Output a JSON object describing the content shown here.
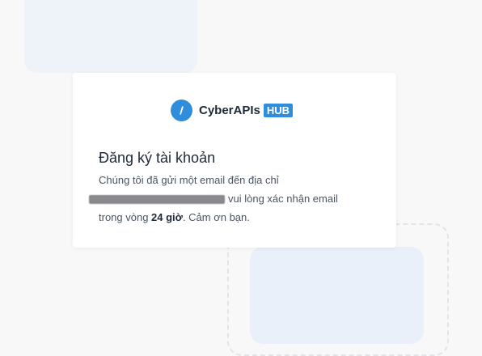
{
  "brand": {
    "name": "CyberAPIs",
    "badge": "HUB",
    "logo_glyph": "/",
    "accent_color": "#2f8ddb"
  },
  "card": {
    "title": "Đăng ký tài khoản",
    "message_line1": "Chúng tôi đã gửi một email đến địa chỉ",
    "message_after_email": "vui lòng xác nhận email",
    "message_line3_prefix": "trong vòng ",
    "message_highlight": "24 giờ",
    "message_line3_suffix": ". Cảm ơn bạn."
  }
}
